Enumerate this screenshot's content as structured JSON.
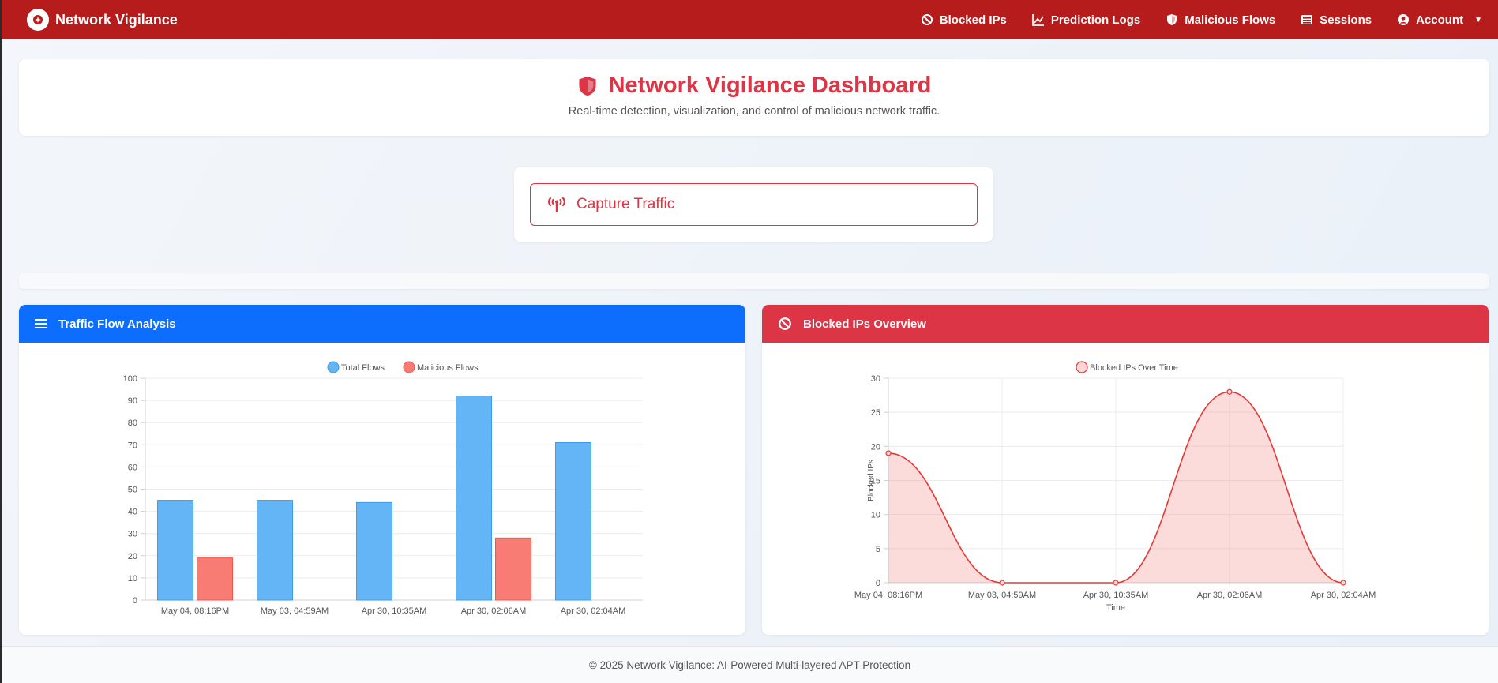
{
  "navbar": {
    "brand": "Network Vigilance",
    "links": [
      {
        "label": "Blocked IPs",
        "icon": "ban-icon"
      },
      {
        "label": "Prediction Logs",
        "icon": "chart-line-icon"
      },
      {
        "label": "Malicious Flows",
        "icon": "shield-icon"
      },
      {
        "label": "Sessions",
        "icon": "table-icon"
      },
      {
        "label": "Account",
        "icon": "user-circle-icon"
      }
    ]
  },
  "header": {
    "title": "Network Vigilance Dashboard",
    "subtitle": "Real-time detection, visualization, and control of malicious network traffic."
  },
  "capture": {
    "label": "Capture Traffic"
  },
  "traffic_card": {
    "title": "Traffic Flow Analysis"
  },
  "blocked_card": {
    "title": "Blocked IPs Overview"
  },
  "footer": {
    "text": "© 2025 Network Vigilance: AI-Powered Multi-layered APT Protection"
  },
  "colors": {
    "navbar": "#b71c1c",
    "accent_red": "#dc3545",
    "accent_blue": "#0d6efd",
    "bar_total": "#64b5f6",
    "bar_malicious": "#f87c74",
    "line_blocked": "#e53935"
  },
  "chart_data": [
    {
      "type": "bar",
      "categories": [
        "May 04, 08:16PM",
        "May 03, 04:59AM",
        "Apr 30, 10:35AM",
        "Apr 30, 02:06AM",
        "Apr 30, 02:04AM"
      ],
      "series": [
        {
          "name": "Total Flows",
          "values": [
            45,
            45,
            44,
            92,
            71
          ]
        },
        {
          "name": "Malicious Flows",
          "values": [
            19,
            0,
            0,
            28,
            0
          ]
        }
      ],
      "ylim": [
        0,
        100
      ],
      "yticks": [
        0,
        10,
        20,
        30,
        40,
        50,
        60,
        70,
        80,
        90,
        100
      ],
      "legend": "top-center",
      "grid": true
    },
    {
      "type": "area",
      "categories": [
        "May 04, 08:16PM",
        "May 03, 04:59AM",
        "Apr 30, 10:35AM",
        "Apr 30, 02:06AM",
        "Apr 30, 02:04AM"
      ],
      "series": [
        {
          "name": "Blocked IPs Over Time",
          "values": [
            19,
            0,
            0,
            28,
            0
          ]
        }
      ],
      "ylim": [
        0,
        30
      ],
      "yticks": [
        0,
        5,
        10,
        15,
        20,
        25,
        30
      ],
      "xlabel": "Time",
      "ylabel": "Blocked IPs",
      "legend": "top-center",
      "grid": true
    }
  ]
}
